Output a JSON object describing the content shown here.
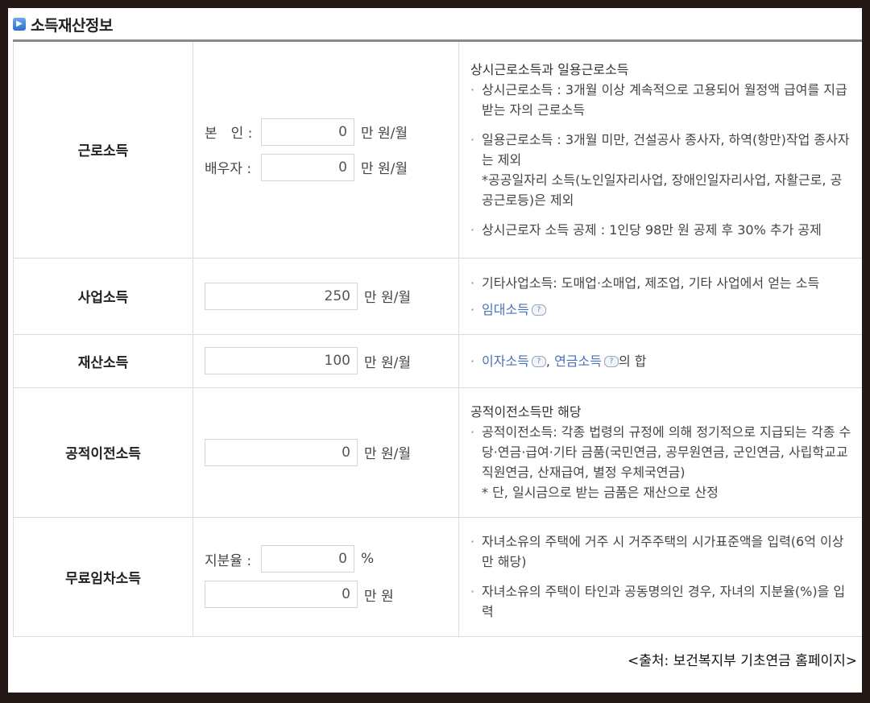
{
  "section": {
    "title": "소득재산정보"
  },
  "rows": {
    "earned": {
      "label": "근로소득",
      "self_label": "본　인 :",
      "self_value": "0",
      "spouse_label": "배우자 :",
      "spouse_value": "0",
      "unit": "만 원/월",
      "desc": {
        "head": "상시근로소득과 일용근로소득",
        "b1": "상시근로소득 : 3개월 이상 계속적으로 고용되어 월정액 급여를 지급 받는 자의 근로소득",
        "b2": "일용근로소득 : 3개월 미만, 건설공사 종사자, 하역(항만)작업 종사자는 제외",
        "note": "*공공일자리 소득(노인일자리사업, 장애인일자리사업, 자활근로, 공공근로등)은 제외",
        "b3": "상시근로자 소득 공제 : 1인당 98만 원 공제 후 30% 추가 공제"
      }
    },
    "business": {
      "label": "사업소득",
      "value": "250",
      "unit": "만 원/월",
      "desc": {
        "b1": "기타사업소득: 도매업·소매업, 제조업, 기타 사업에서 얻는 소득",
        "link": "임대소득"
      }
    },
    "property": {
      "label": "재산소득",
      "value": "100",
      "unit": "만 원/월",
      "desc": {
        "link1": "이자소득",
        "sep": ", ",
        "link2": "연금소득",
        "tail": "의 합"
      }
    },
    "transfer": {
      "label": "공적이전소득",
      "value": "0",
      "unit": "만 원/월",
      "desc": {
        "head": "공적이전소득만 해당",
        "b1": "공적이전소득: 각종 법령의 규정에 의해 정기적으로 지급되는 각종 수당·연금·급여·기타 금품(국민연금, 공무원연금, 군인연금, 사립학교교직원연금, 산재급여, 별정 우체국연금)",
        "note": "* 단, 일시금으로 받는 금품은 재산으로 산정"
      }
    },
    "rentfree": {
      "label": "무료임차소득",
      "share_label": "지분율 :",
      "share_value": "0",
      "share_unit": "%",
      "amount_value": "0",
      "amount_unit": "만 원",
      "desc": {
        "b1": "자녀소유의 주택에 거주 시 거주주택의 시가표준액을 입력(6억 이상만 해당)",
        "b2": "자녀소유의 주택이 타인과 공동명의인 경우, 자녀의 지분율(%)을 입력"
      }
    }
  },
  "source": "<출처: 보건복지부 기초연금 홈페이지>"
}
